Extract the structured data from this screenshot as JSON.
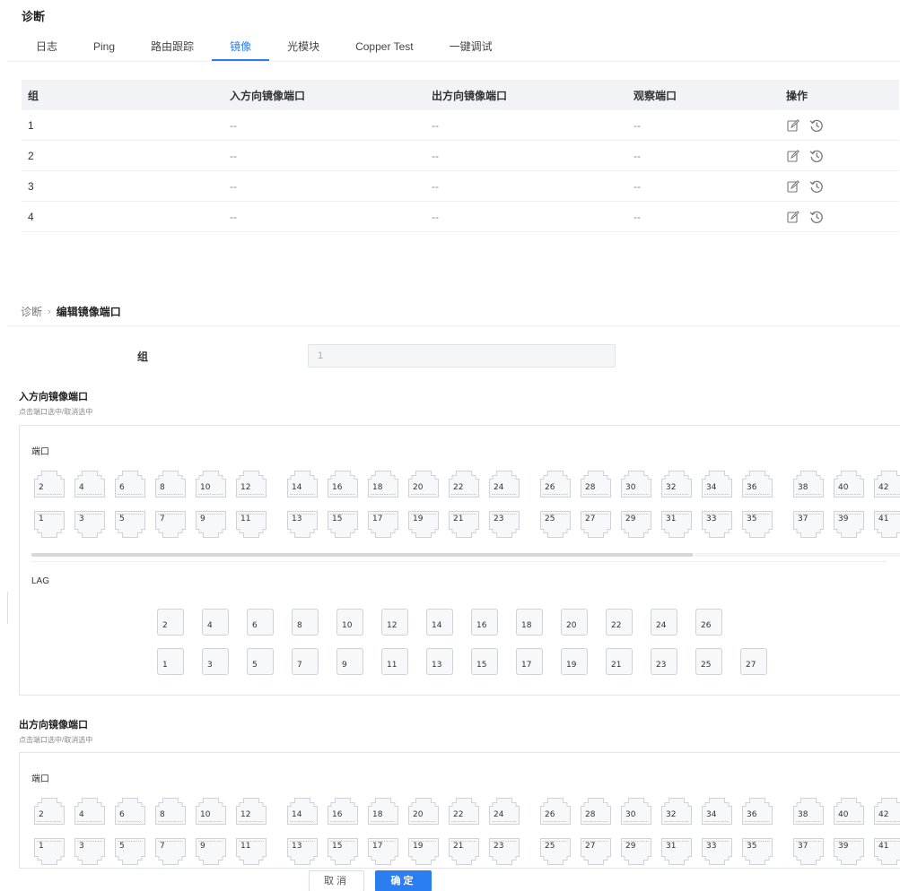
{
  "page_title": "诊断",
  "tabs": [
    {
      "label": "日志",
      "active": false
    },
    {
      "label": "Ping",
      "active": false
    },
    {
      "label": "路由跟踪",
      "active": false
    },
    {
      "label": "镜像",
      "active": true
    },
    {
      "label": "光模块",
      "active": false
    },
    {
      "label": "Copper Test",
      "active": false
    },
    {
      "label": "一键调试",
      "active": false
    }
  ],
  "colors": {
    "accent": "#2a7ef0"
  },
  "table": {
    "headers": [
      "组",
      "入方向镜像端口",
      "出方向镜像端口",
      "观察端口",
      "操作"
    ],
    "rows": [
      {
        "group": "1",
        "ingress": "--",
        "egress": "--",
        "monitor": "--"
      },
      {
        "group": "2",
        "ingress": "--",
        "egress": "--",
        "monitor": "--"
      },
      {
        "group": "3",
        "ingress": "--",
        "egress": "--",
        "monitor": "--"
      },
      {
        "group": "4",
        "ingress": "--",
        "egress": "--",
        "monitor": "--"
      }
    ],
    "action_icons": [
      "edit-icon",
      "history-icon"
    ]
  },
  "breadcrumb": {
    "root": "诊断",
    "separator": "›",
    "current": "编辑镜像端口"
  },
  "form": {
    "group_label": "组",
    "group_value": "1",
    "ingress": {
      "title": "入方向镜像端口",
      "hint": "点击端口选中/取消选中"
    },
    "egress": {
      "title": "出方向镜像端口",
      "hint": "点击端口选中/取消选中"
    },
    "port_label": "端口",
    "lag_label": "LAG",
    "ports_even": [
      "2",
      "4",
      "6",
      "8",
      "10",
      "12",
      "14",
      "16",
      "18",
      "20",
      "22",
      "24",
      "26",
      "28",
      "30",
      "32",
      "34",
      "36",
      "38",
      "40",
      "42"
    ],
    "ports_odd": [
      "1",
      "3",
      "5",
      "7",
      "9",
      "11",
      "13",
      "15",
      "17",
      "19",
      "21",
      "23",
      "25",
      "27",
      "29",
      "31",
      "33",
      "35",
      "37",
      "39",
      "41"
    ],
    "lag_even": [
      "2",
      "4",
      "6",
      "8",
      "10",
      "12",
      "14",
      "16",
      "18",
      "20",
      "22",
      "24",
      "26"
    ],
    "lag_odd": [
      "1",
      "3",
      "5",
      "7",
      "9",
      "11",
      "13",
      "15",
      "17",
      "19",
      "21",
      "23",
      "25",
      "27"
    ]
  },
  "buttons": {
    "cancel": "取消",
    "ok": "确定"
  }
}
